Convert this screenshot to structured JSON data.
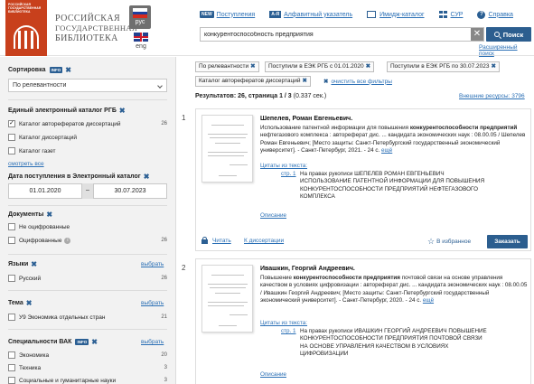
{
  "header": {
    "logo_small": "РОССИЙСКАЯ ГОСУДАРСТВЕННАЯ БИБЛИОТЕКА",
    "logo_lines": [
      "РОССИЙСКАЯ",
      "ГОСУДАРСТВЕННАЯ",
      "БИБЛИОТЕКА"
    ],
    "lang_ru": "рус",
    "lang_en": "eng",
    "nav": [
      {
        "badge": "NEW",
        "label": "Поступления"
      },
      {
        "badge": "А-Я",
        "label": "Алфавитный указатель"
      },
      {
        "icon": "image-catalog-icon",
        "label": "Имидж-каталог"
      },
      {
        "icon": "grid-icon",
        "label": "СУР"
      },
      {
        "icon": "help-icon",
        "label": "Справка"
      }
    ],
    "search_value": "конкурентоспособность предприятия",
    "search_button": "Поиск",
    "clear_glyph": "✕",
    "advanced_search": "Расширенный поиск"
  },
  "sidebar": {
    "sort_label": "Сортировка",
    "info_badge": "INFO",
    "sort_value": "По релевантности",
    "catalog_heading": "Единый электронный каталог РГБ",
    "catalogs": [
      {
        "label": "Каталог авторефератов диссертаций",
        "count": "26",
        "checked": true
      },
      {
        "label": "Каталог диссертаций",
        "count": "",
        "checked": false
      },
      {
        "label": "Каталог газет",
        "count": "",
        "checked": false
      }
    ],
    "show_all": "смотреть все",
    "date_heading": "Дата поступления в Электронный каталог",
    "date_from": "01.01.2020",
    "date_sep": "–",
    "date_to": "30.07.2023",
    "docs_heading": "Документы",
    "docs": [
      {
        "label": "Не оцифрованные",
        "count": ""
      },
      {
        "label": "Оцифрованные",
        "count": "26"
      }
    ],
    "lang_heading": "Языки",
    "choose": "выбрать",
    "langs": [
      {
        "label": "Русский",
        "count": "26"
      }
    ],
    "theme_heading": "Тема",
    "themes": [
      {
        "label": "У9 Экономика отдельных стран",
        "count": "21"
      }
    ],
    "vak_heading": "Специальности ВАК",
    "vak": [
      {
        "label": "Экономика",
        "count": "20"
      },
      {
        "label": "Техника",
        "count": "3"
      },
      {
        "label": "Социальные и гуманитарные науки",
        "count": "3"
      }
    ]
  },
  "filters": {
    "chips": [
      "По релевантности",
      "Поступили в ЕЭК РГБ с 01.01.2020",
      "Поступили в ЕЭК РГБ по 30.07.2023",
      "Каталог авторефератов диссертаций"
    ],
    "chip_x": "✖",
    "clear_all": "очистить все фильтры"
  },
  "results": {
    "prefix": "Результатов: 26, страница 1 / 3",
    "time": " (0.337 сек.)",
    "external": "Внешние ресурсы: 3796"
  },
  "cards": [
    {
      "num": "1",
      "author": "Шепелев, Роман Евгеньевич.",
      "desc_pre": "Использование патентной информации для повышения ",
      "desc_bold": "конкурентоспособности предприятий",
      "desc_post": " нефтегазового комплекса : автореферат дис. ... кандидата экономических наук : 08.00.05 / Шепелев Роман Евгеньевич; [Место защиты: Санкт-Петербургский государственный экономический университет]. - Санкт-Петербург, 2021. - 24 с. ",
      "more": "ещё",
      "cite": "Цитаты из текста:",
      "page": "стр. 1",
      "annotation": "На правах рукописи ШЕПЕЛЕВ РОМАН ЕВГЕНЬЕВИЧ ИСПОЛЬЗОВАНИЕ ПАТЕНТНОЙ ИНФОРМАЦИИ ДЛЯ ПОВЫШЕНИЯ КОНКУРЕНТОСПОСОБНОСТИ ПРЕДПРИЯТИЙ НЕФТЕГАЗОВОГО КОМПЛЕКСА",
      "opis": "Описание",
      "read": "Читать",
      "to_diss": "К диссертации",
      "fav": "В избранное",
      "order": "Заказать"
    },
    {
      "num": "2",
      "author": "Ивашкин, Георгий Андреевич.",
      "desc_pre": "Повышение ",
      "desc_bold": "конкурентоспособности предприятия",
      "desc_post": " почтовой связи на основе управления качеством в условиях цифровизации : автореферат дис. ... кандидата экономических наук : 08.00.05 / Ивашкин Георгий Андреевич; [Место защиты: Санкт-Петербургский государственный экономический университет]. - Санкт-Петербург, 2020. - 24 с. ",
      "more": "ещё",
      "cite": "Цитаты из текста:",
      "page": "стр. 1",
      "annotation": "На правах рукописи ИВАШКИН ГЕОРГИЙ АНДРЕЕВИЧ ПОВЫШЕНИЕ КОНКУРЕНТОСПОСОБНОСТИ ПРЕДПРИЯТИЯ ПОЧТОВОЙ СВЯЗИ НА ОСНОВЕ УПРАВЛЕНИЯ КАЧЕСТВОМ В УСЛОВИЯХ ЦИФРОВИЗАЦИИ",
      "opis": "Описание"
    }
  ],
  "colors": {
    "brand": "#c8401c",
    "primary": "#2c5e8f",
    "link": "#2a6fb5",
    "sidebar_bg": "#f2f2f2"
  }
}
